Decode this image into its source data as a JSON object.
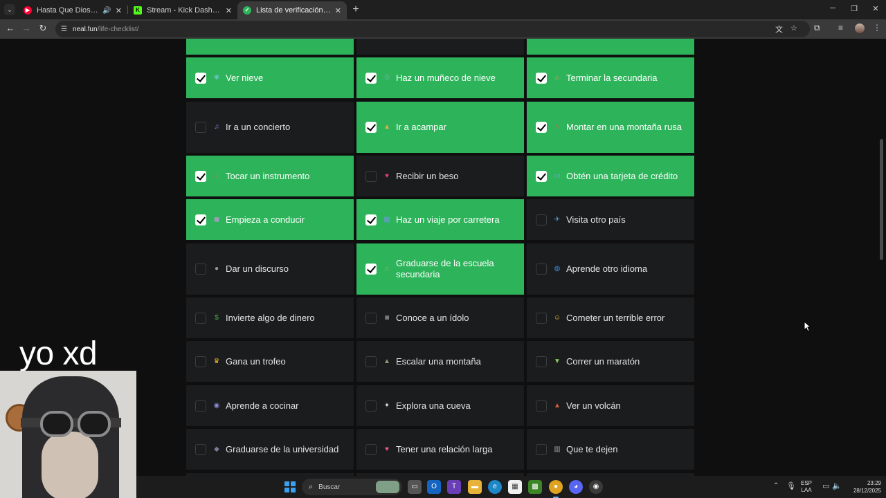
{
  "browser": {
    "tabs": [
      {
        "title": "Hasta Que Dios Diga - YouTube",
        "favicon": "youtube-icon",
        "favicon_color": "#ff0033",
        "active": false,
        "audio": true
      },
      {
        "title": "Stream - Kick Dashboard",
        "favicon": "kick-icon",
        "favicon_color": "#53fc18",
        "active": false,
        "audio": false
      },
      {
        "title": "Lista de verificación de vida",
        "favicon": "check-icon",
        "favicon_color": "#2db45a",
        "active": true,
        "audio": false
      }
    ],
    "url_host": "neal.fun",
    "url_path": "/life-checklist/"
  },
  "checklist": {
    "colors": {
      "done": "#2db45a",
      "todo": "#1b1c1e"
    },
    "items": [
      {
        "label": "Ver nieve",
        "checked": true,
        "icon": "snowflake-icon"
      },
      {
        "label": "Haz un muñeco de nieve",
        "checked": true,
        "icon": "snowman-icon"
      },
      {
        "label": "Terminar la secundaria",
        "checked": true,
        "icon": "school-icon"
      },
      {
        "label": "Ir a un concierto",
        "checked": false,
        "icon": "music-notes-icon"
      },
      {
        "label": "Ir a acampar",
        "checked": true,
        "icon": "camping-icon"
      },
      {
        "label": "Montar en una montaña rusa",
        "checked": true,
        "icon": "roller-coaster-icon"
      },
      {
        "label": "Tocar un instrumento",
        "checked": true,
        "icon": "guitar-icon"
      },
      {
        "label": "Recibir un beso",
        "checked": false,
        "icon": "kiss-icon"
      },
      {
        "label": "Obtén una tarjeta de crédito",
        "checked": true,
        "icon": "credit-card-icon"
      },
      {
        "label": "Empieza a conducir",
        "checked": true,
        "icon": "car-icon"
      },
      {
        "label": "Haz un viaje por carretera",
        "checked": true,
        "icon": "map-icon"
      },
      {
        "label": "Visita otro país",
        "checked": false,
        "icon": "airplane-icon"
      },
      {
        "label": "Dar un discurso",
        "checked": false,
        "icon": "microphone-icon"
      },
      {
        "label": "Graduarse de la escuela secundaria",
        "checked": true,
        "icon": "school-icon"
      },
      {
        "label": "Aprende otro idioma",
        "checked": false,
        "icon": "globe-icon"
      },
      {
        "label": "Invierte algo de dinero",
        "checked": false,
        "icon": "money-icon"
      },
      {
        "label": "Conoce a un ídolo",
        "checked": false,
        "icon": "camera-icon"
      },
      {
        "label": "Cometer un terrible error",
        "checked": false,
        "icon": "grimace-icon"
      },
      {
        "label": "Gana un trofeo",
        "checked": false,
        "icon": "trophy-icon"
      },
      {
        "label": "Escalar una montaña",
        "checked": false,
        "icon": "mountain-icon"
      },
      {
        "label": "Correr un maratón",
        "checked": false,
        "icon": "running-shirt-icon"
      },
      {
        "label": "Aprende a cocinar",
        "checked": false,
        "icon": "cooking-icon"
      },
      {
        "label": "Explora una cueva",
        "checked": false,
        "icon": "flashlight-icon"
      },
      {
        "label": "Ver un volcán",
        "checked": false,
        "icon": "volcano-icon"
      },
      {
        "label": "Graduarse de la universidad",
        "checked": false,
        "icon": "graduation-cap-icon"
      },
      {
        "label": "Tener una relación larga",
        "checked": false,
        "icon": "hearts-icon"
      },
      {
        "label": "Que te dejen",
        "checked": false,
        "icon": "wastebasket-icon"
      }
    ]
  },
  "overlay": {
    "caption": "yo xd"
  },
  "taskbar": {
    "search_placeholder": "Buscar",
    "lang_line1": "ESP",
    "lang_line2": "LAA",
    "time": "23:29",
    "date": "28/12/2025",
    "accent": "#3ba0f0"
  }
}
